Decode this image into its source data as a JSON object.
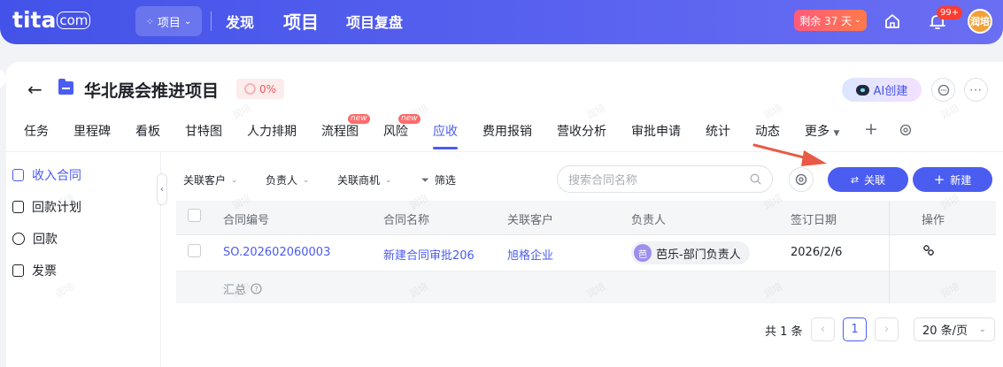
{
  "topbar": {
    "logo_main": "tita",
    "logo_suffix": "com",
    "project_switcher_label": "项目",
    "nav": [
      "发现",
      "项目",
      "项目复盘"
    ],
    "trial_label": "剩余 37 天",
    "notification_count": "99+",
    "user_avatar_text": "润培"
  },
  "project": {
    "title": "华北展会推进项目",
    "progress": "0%",
    "ai_button_label": "AI创建"
  },
  "tabs": [
    {
      "label": "任务"
    },
    {
      "label": "里程碑"
    },
    {
      "label": "看板"
    },
    {
      "label": "甘特图"
    },
    {
      "label": "人力排期"
    },
    {
      "label": "流程图",
      "tag": "new"
    },
    {
      "label": "风险",
      "tag": "new"
    },
    {
      "label": "应收"
    },
    {
      "label": "费用报销"
    },
    {
      "label": "营收分析"
    },
    {
      "label": "审批申请"
    },
    {
      "label": "统计"
    },
    {
      "label": "动态"
    },
    {
      "label": "更多"
    }
  ],
  "sidebar": {
    "items": [
      {
        "label": "收入合同"
      },
      {
        "label": "回款计划"
      },
      {
        "label": "回款"
      },
      {
        "label": "发票"
      }
    ]
  },
  "filters": {
    "customer": "关联客户",
    "owner": "负责人",
    "opportunity": "关联商机",
    "filter": "筛选",
    "search_placeholder": "搜索合同名称",
    "link_button": "关联",
    "new_button": "新建"
  },
  "table": {
    "columns": [
      "合同编号",
      "合同名称",
      "关联客户",
      "负责人",
      "签订日期",
      "操作"
    ],
    "rows": [
      {
        "contract_no": "SO.202602060003",
        "contract_name": "新建合同审批206",
        "customer": "旭格企业",
        "owner_avatar": "芭",
        "owner": "芭乐-部门负责人",
        "signed_date": "2026/2/6"
      }
    ],
    "summary_label": "汇总"
  },
  "pagination": {
    "total": "共 1 条",
    "current_page": "1",
    "page_size": "20 条/页"
  },
  "colors": {
    "brand": "#4b5cf0",
    "topbar": "#4352e8",
    "annotation_arrow": "#e85a45"
  },
  "watermark": "润培"
}
